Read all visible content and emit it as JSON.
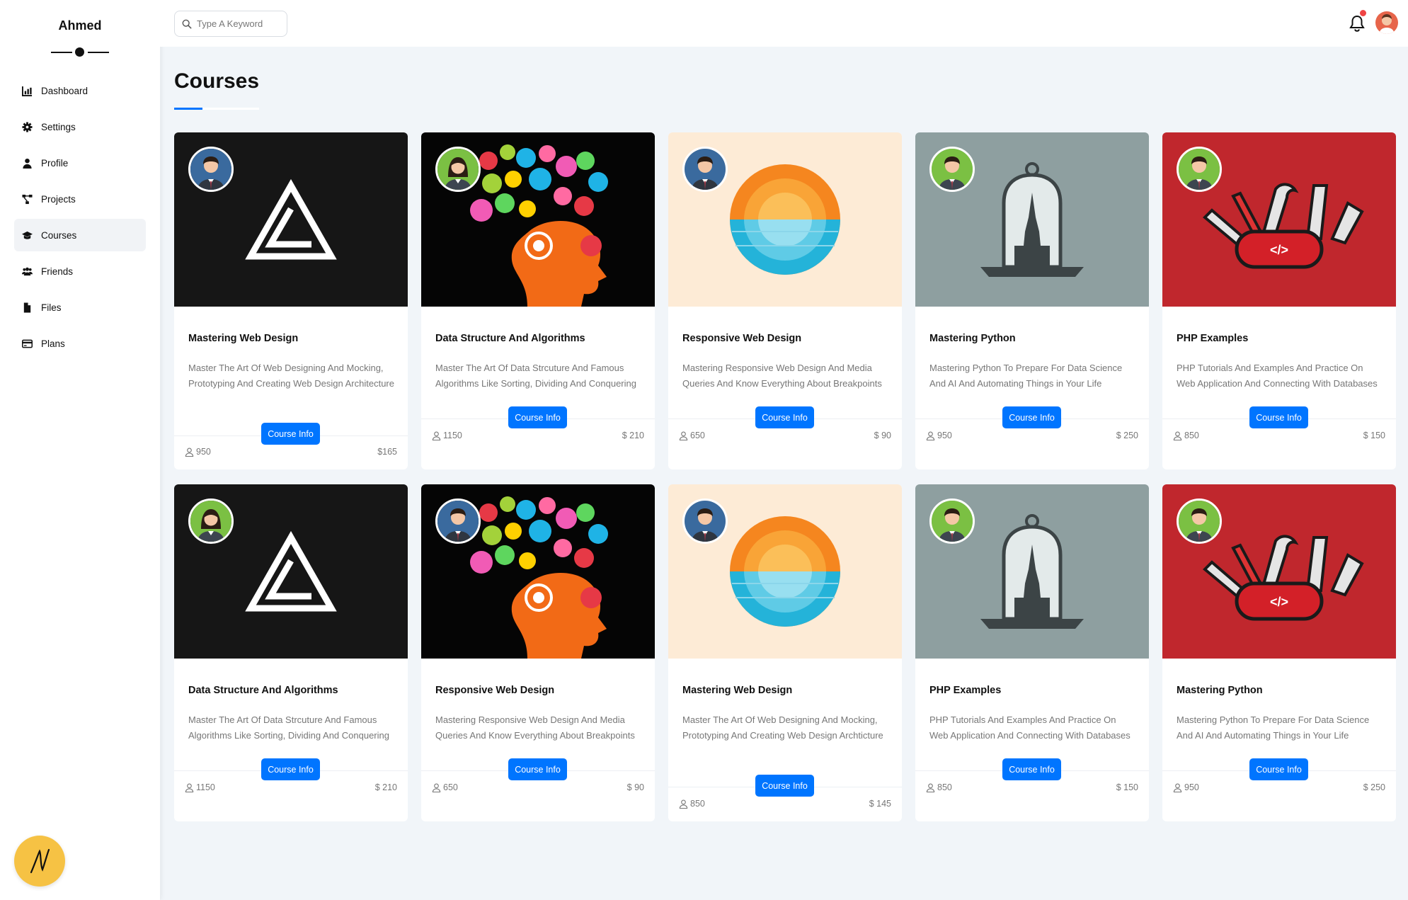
{
  "sidebar": {
    "brand": "Ahmed",
    "items": [
      {
        "label": "Dashboard",
        "icon": "chart-icon",
        "active": false
      },
      {
        "label": "Settings",
        "icon": "gear-icon",
        "active": false
      },
      {
        "label": "Profile",
        "icon": "user-icon",
        "active": false
      },
      {
        "label": "Projects",
        "icon": "diagram-icon",
        "active": false
      },
      {
        "label": "Courses",
        "icon": "graduation-cap-icon",
        "active": true
      },
      {
        "label": "Friends",
        "icon": "users-icon",
        "active": false
      },
      {
        "label": "Files",
        "icon": "file-icon",
        "active": false
      },
      {
        "label": "Plans",
        "icon": "credit-card-icon",
        "active": false
      }
    ]
  },
  "header": {
    "search_placeholder": "Type A Keyword",
    "notification_dot_color": "#ef4444"
  },
  "page": {
    "title": "Courses",
    "accent_color": "#0075ff"
  },
  "courses": [
    {
      "title": "Mastering Web Design",
      "description": "Master The Art Of Web Designing And Mocking, Prototyping And Creating Web Design Architecture",
      "students": "950",
      "price": "$165",
      "button": "Course Info",
      "image": "black-logo",
      "avatar": "blue-man"
    },
    {
      "title": "Data Structure And Algorithms",
      "description": "Master The Art Of Data Strcuture And Famous Algorithms Like Sorting, Dividing And Conquering",
      "students": "1150",
      "price": "$ 210",
      "button": "Course Info",
      "image": "brain-head",
      "avatar": "green-woman"
    },
    {
      "title": "Responsive Web Design",
      "description": "Mastering Responsive Web Design And Media Queries And Know Everything About Breakpoints",
      "students": "650",
      "price": "$ 90",
      "button": "Course Info",
      "image": "sunset",
      "avatar": "blue-man"
    },
    {
      "title": "Mastering Python",
      "description": "Mastering Python To Prepare For Data Science And AI And Automating Things in Your Life",
      "students": "950",
      "price": "$ 250",
      "button": "Course Info",
      "image": "bell-jar",
      "avatar": "green-man"
    },
    {
      "title": "PHP Examples",
      "description": "PHP Tutorials And Examples And Practice On Web Application And Connecting With Databases",
      "students": "850",
      "price": "$ 150",
      "button": "Course Info",
      "image": "swiss-knife",
      "avatar": "green-man"
    },
    {
      "title": "Data Structure And Algorithms",
      "description": "Master The Art Of Data Strcuture And Famous Algorithms Like Sorting, Dividing And Conquering",
      "students": "1150",
      "price": "$ 210",
      "button": "Course Info",
      "image": "black-logo",
      "avatar": "green-woman"
    },
    {
      "title": "Responsive Web Design",
      "description": "Mastering Responsive Web Design And Media Queries And Know Everything About Breakpoints",
      "students": "650",
      "price": "$ 90",
      "button": "Course Info",
      "image": "brain-head",
      "avatar": "blue-man"
    },
    {
      "title": "Mastering Web Design",
      "description": "Master The Art Of Web Designing And Mocking, Prototyping And Creating Web Design Archticture",
      "students": "850",
      "price": "$ 145",
      "button": "Course Info",
      "image": "sunset",
      "avatar": "blue-man"
    },
    {
      "title": "PHP Examples",
      "description": "PHP Tutorials And Examples And Practice On Web Application And Connecting With Databases",
      "students": "850",
      "price": "$ 150",
      "button": "Course Info",
      "image": "bell-jar",
      "avatar": "green-man"
    },
    {
      "title": "Mastering Python",
      "description": "Mastering Python To Prepare For Data Science And AI And Automating Things in Your Life",
      "students": "950",
      "price": "$ 250",
      "button": "Course Info",
      "image": "swiss-knife",
      "avatar": "green-man"
    }
  ]
}
